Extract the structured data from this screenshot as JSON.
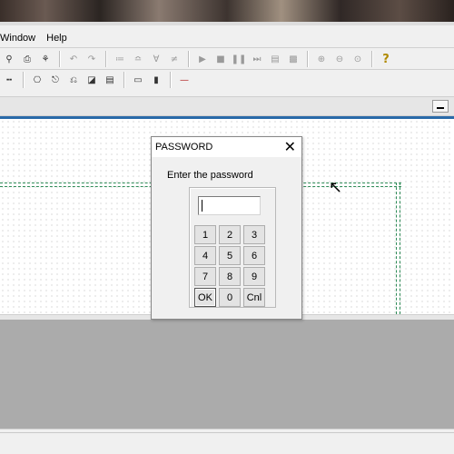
{
  "menubar": {
    "items": [
      "Window",
      "Help"
    ]
  },
  "toolbar1": {
    "icons": [
      "print-preview-icon",
      "print-icon",
      "find-icon",
      "undo-icon",
      "redo-icon",
      "tool-a-icon",
      "tool-b-icon",
      "tool-c-icon",
      "tool-d-icon",
      "run-icon",
      "stop-icon",
      "pause-icon",
      "step-icon",
      "monitor-icon",
      "monitor-b-icon",
      "zoom-in-icon",
      "zoom-out-icon",
      "zoom-fit-icon",
      "help-icon"
    ]
  },
  "toolbar2": {
    "icons": [
      "contact-icon",
      "timer-icon",
      "coil-icon",
      "contact-b-icon",
      "block-icon",
      "function-icon",
      "sub-a-icon",
      "sub-b-icon",
      "line-icon"
    ]
  },
  "dialog": {
    "title": "PASSWORD",
    "prompt": "Enter the password",
    "password_value": "",
    "keys": [
      "1",
      "2",
      "3",
      "4",
      "5",
      "6",
      "7",
      "8",
      "9",
      "OK",
      "0",
      "Cnl"
    ]
  }
}
